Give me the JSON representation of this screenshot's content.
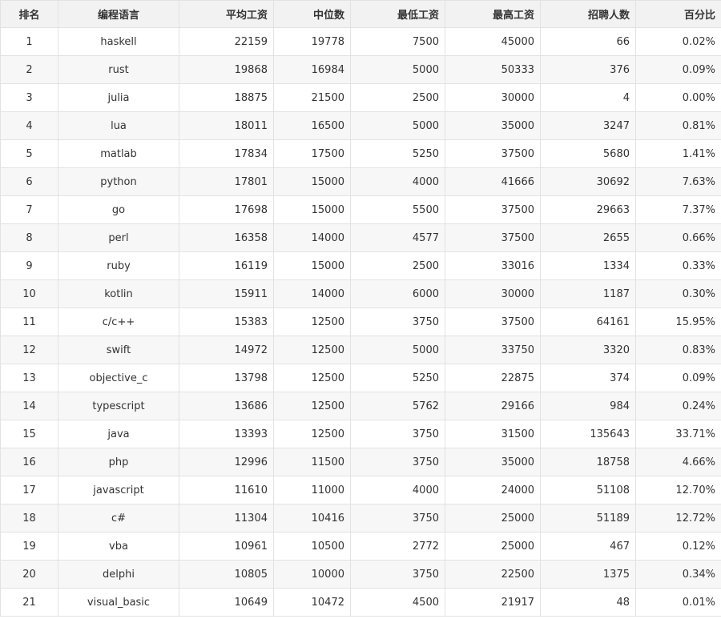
{
  "table": {
    "headers": [
      "排名",
      "编程语言",
      "平均工资",
      "中位数",
      "最低工资",
      "最高工资",
      "招聘人数",
      "百分比"
    ],
    "rows": [
      [
        "1",
        "haskell",
        "22159",
        "19778",
        "7500",
        "45000",
        "66",
        "0.02%"
      ],
      [
        "2",
        "rust",
        "19868",
        "16984",
        "5000",
        "50333",
        "376",
        "0.09%"
      ],
      [
        "3",
        "julia",
        "18875",
        "21500",
        "2500",
        "30000",
        "4",
        "0.00%"
      ],
      [
        "4",
        "lua",
        "18011",
        "16500",
        "5000",
        "35000",
        "3247",
        "0.81%"
      ],
      [
        "5",
        "matlab",
        "17834",
        "17500",
        "5250",
        "37500",
        "5680",
        "1.41%"
      ],
      [
        "6",
        "python",
        "17801",
        "15000",
        "4000",
        "41666",
        "30692",
        "7.63%"
      ],
      [
        "7",
        "go",
        "17698",
        "15000",
        "5500",
        "37500",
        "29663",
        "7.37%"
      ],
      [
        "8",
        "perl",
        "16358",
        "14000",
        "4577",
        "37500",
        "2655",
        "0.66%"
      ],
      [
        "9",
        "ruby",
        "16119",
        "15000",
        "2500",
        "33016",
        "1334",
        "0.33%"
      ],
      [
        "10",
        "kotlin",
        "15911",
        "14000",
        "6000",
        "30000",
        "1187",
        "0.30%"
      ],
      [
        "11",
        "c/c++",
        "15383",
        "12500",
        "3750",
        "37500",
        "64161",
        "15.95%"
      ],
      [
        "12",
        "swift",
        "14972",
        "12500",
        "5000",
        "33750",
        "3320",
        "0.83%"
      ],
      [
        "13",
        "objective_c",
        "13798",
        "12500",
        "5250",
        "22875",
        "374",
        "0.09%"
      ],
      [
        "14",
        "typescript",
        "13686",
        "12500",
        "5762",
        "29166",
        "984",
        "0.24%"
      ],
      [
        "15",
        "java",
        "13393",
        "12500",
        "3750",
        "31500",
        "135643",
        "33.71%"
      ],
      [
        "16",
        "php",
        "12996",
        "11500",
        "3750",
        "35000",
        "18758",
        "4.66%"
      ],
      [
        "17",
        "javascript",
        "11610",
        "11000",
        "4000",
        "24000",
        "51108",
        "12.70%"
      ],
      [
        "18",
        "c#",
        "11304",
        "10416",
        "3750",
        "25000",
        "51189",
        "12.72%"
      ],
      [
        "19",
        "vba",
        "10961",
        "10500",
        "2772",
        "25000",
        "467",
        "0.12%"
      ],
      [
        "20",
        "delphi",
        "10805",
        "10000",
        "3750",
        "22500",
        "1375",
        "0.34%"
      ],
      [
        "21",
        "visual_basic",
        "10649",
        "10472",
        "4500",
        "21917",
        "48",
        "0.01%"
      ]
    ]
  }
}
